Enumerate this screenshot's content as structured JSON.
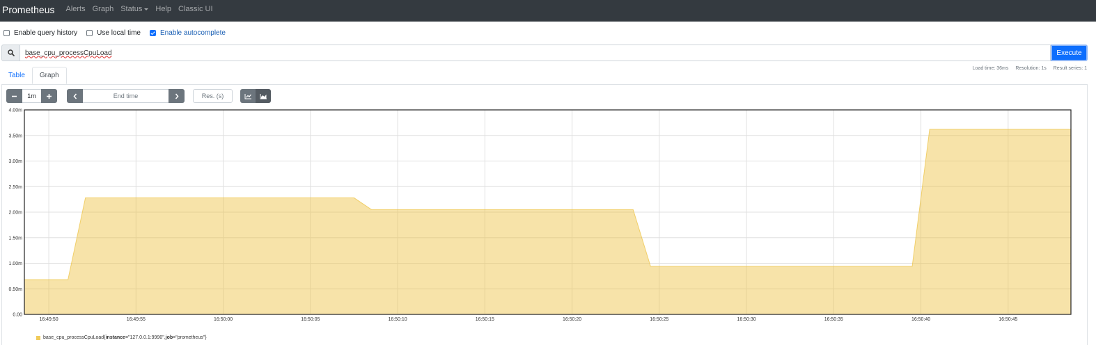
{
  "navbar": {
    "brand": "Prometheus",
    "links": [
      "Alerts",
      "Graph",
      "Status",
      "Help",
      "Classic UI"
    ]
  },
  "options": [
    {
      "label": "Enable query history",
      "checked": false
    },
    {
      "label": "Use local time",
      "checked": false
    },
    {
      "label": "Enable autocomplete",
      "checked": true
    }
  ],
  "query": {
    "value": "base_cpu_processCpuLoad",
    "execute_label": "Execute"
  },
  "stats": {
    "load_time": "Load time: 36ms",
    "resolution": "Resolution: 1s",
    "result_series": "Result series: 1"
  },
  "tabs": [
    {
      "label": "Table",
      "active": false
    },
    {
      "label": "Graph",
      "active": true
    }
  ],
  "controls": {
    "range": "1m",
    "end_time_placeholder": "End time",
    "res_placeholder": "Res. (s)"
  },
  "chart_data": {
    "type": "area",
    "color": "#edc240",
    "x_ticks": [
      "16:49:50",
      "16:49:55",
      "16:50:00",
      "16:50:05",
      "16:50:10",
      "16:50:15",
      "16:50:20",
      "16:50:25",
      "16:50:30",
      "16:50:35",
      "16:50:40",
      "16:50:45"
    ],
    "y_ticks": [
      "4.00m",
      "3.50m",
      "3.00m",
      "2.50m",
      "2.00m",
      "1.50m",
      "1.00m",
      "0.50m",
      "0.00"
    ],
    "ylim": [
      0,
      0.004
    ],
    "xlim_seconds": [
      -1.4,
      58.6
    ],
    "x": [
      -1.4,
      1.1,
      2.1,
      17.5,
      18.5,
      33.5,
      34.5,
      49.5,
      50.5,
      58.6
    ],
    "y": [
      0.00068,
      0.00068,
      0.00228,
      0.00228,
      0.00205,
      0.00205,
      0.00094,
      0.00094,
      0.00362,
      0.00362
    ],
    "grid": true,
    "series": [
      {
        "name": "base_cpu_processCpuLoad",
        "labels": [
          {
            "key": "instance",
            "value": "\"127.0.0.1:9990\""
          },
          {
            "key": "job",
            "value": "\"prometheus\""
          }
        ]
      }
    ]
  }
}
